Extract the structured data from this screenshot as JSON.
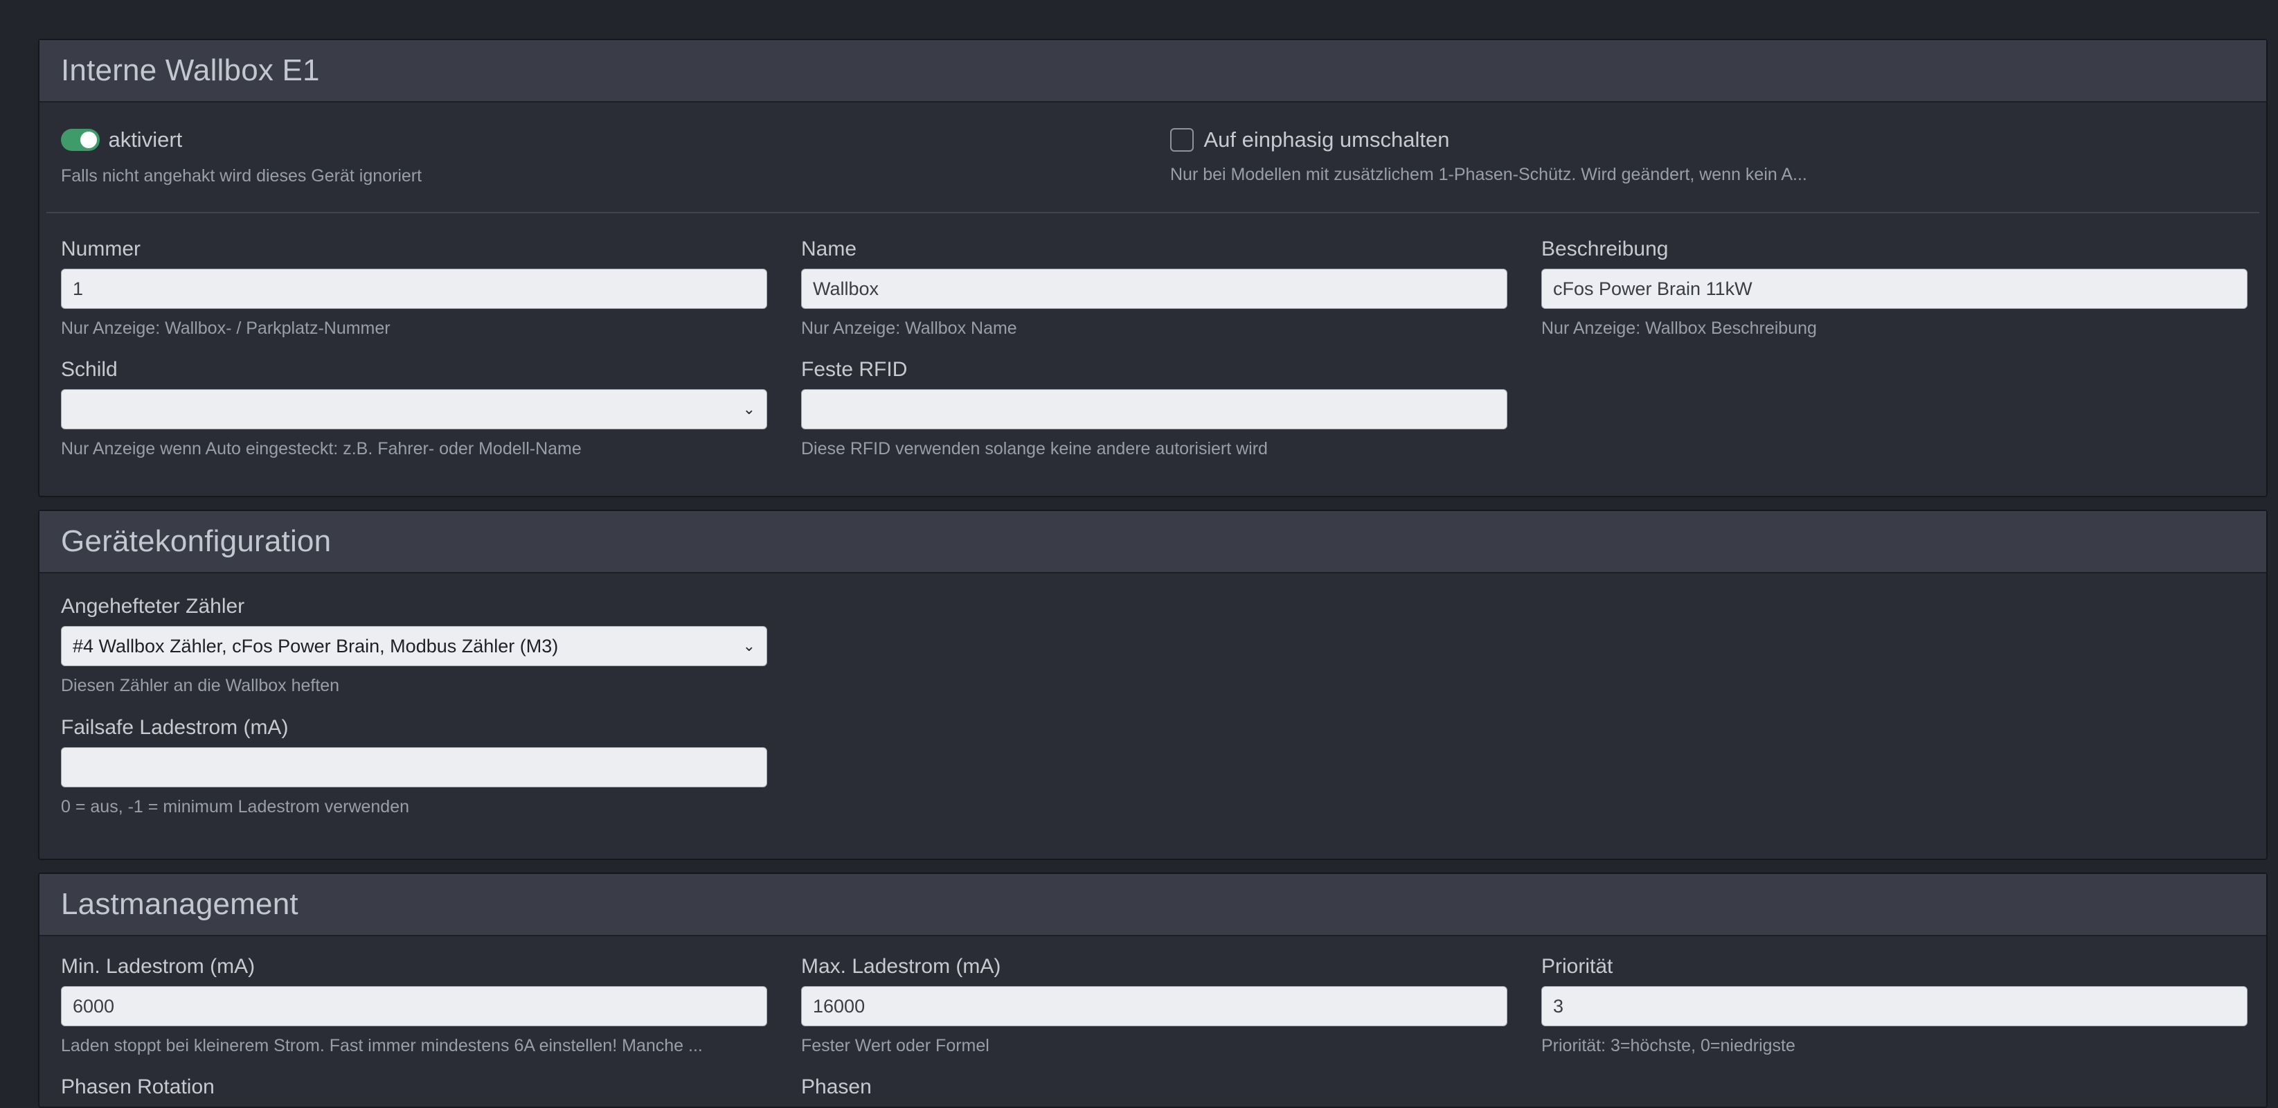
{
  "sections": {
    "wallbox": {
      "title": "Interne Wallbox E1",
      "enabled": {
        "label": "aktiviert",
        "help": "Falls nicht angehakt wird dieses Gerät ignoriert",
        "checked": true
      },
      "single_phase": {
        "label": "Auf einphasig umschalten",
        "help": "Nur bei Modellen mit zusätzlichem 1-Phasen-Schütz. Wird geändert, wenn kein A...",
        "checked": false
      },
      "number": {
        "label": "Nummer",
        "value": "1",
        "help": "Nur Anzeige: Wallbox- / Parkplatz-Nummer"
      },
      "name": {
        "label": "Name",
        "value": "Wallbox",
        "help": "Nur Anzeige: Wallbox Name"
      },
      "description": {
        "label": "Beschreibung",
        "value": "cFos Power Brain 11kW",
        "help": "Nur Anzeige: Wallbox Beschreibung"
      },
      "sign": {
        "label": "Schild",
        "value": "",
        "help": "Nur Anzeige wenn Auto eingesteckt: z.B. Fahrer- oder Modell-Name"
      },
      "rfid": {
        "label": "Feste RFID",
        "value": "",
        "help": "Diese RFID verwenden solange keine andere autorisiert wird"
      }
    },
    "device": {
      "title": "Gerätekonfiguration",
      "meter": {
        "label": "Angehefteter Zähler",
        "value": "#4 Wallbox Zähler, cFos Power Brain, Modbus Zähler (M3)",
        "help": "Diesen Zähler an die Wallbox heften"
      },
      "failsafe": {
        "label": "Failsafe Ladestrom (mA)",
        "value": "",
        "help": "0 = aus, -1 = minimum Ladestrom verwenden"
      }
    },
    "load": {
      "title": "Lastmanagement",
      "min_current": {
        "label": "Min. Ladestrom (mA)",
        "value": "6000",
        "help": "Laden stoppt bei kleinerem Strom. Fast immer mindestens 6A einstellen! Manche ..."
      },
      "max_current": {
        "label": "Max. Ladestrom (mA)",
        "value": "16000",
        "help": "Fester Wert oder Formel"
      },
      "priority": {
        "label": "Priorität",
        "value": "3",
        "help": "Priorität: 3=höchste, 0=niedrigste"
      },
      "phase_rotation": {
        "label": "Phasen Rotation"
      },
      "phases": {
        "label": "Phasen"
      }
    }
  },
  "colors": {
    "toggle_on": "#3f9b6a",
    "page_bg": "#22252b",
    "card_bg": "#2b2d36",
    "header_bg": "#3a3d48"
  }
}
